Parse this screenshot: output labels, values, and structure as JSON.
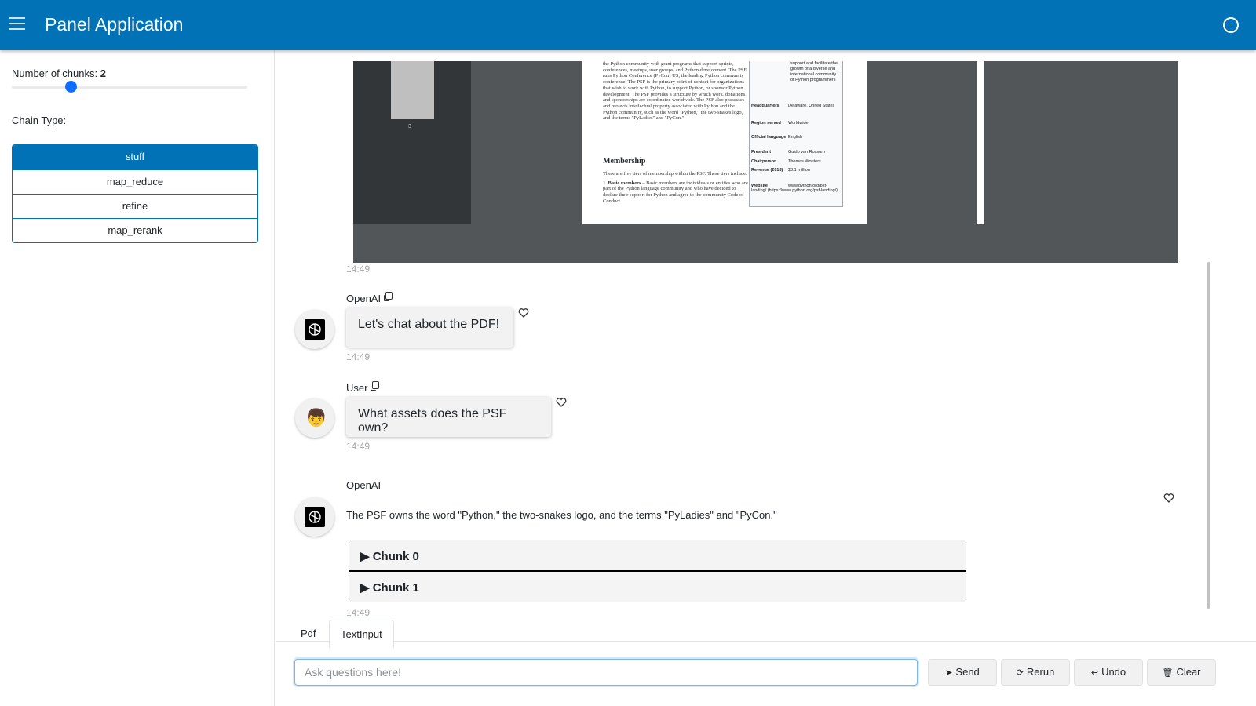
{
  "header": {
    "title": "Panel Application"
  },
  "sidebar": {
    "slider": {
      "label": "Number of chunks:",
      "value": "2",
      "fraction": 0.25
    },
    "chain_type_label": "Chain Type:",
    "chain_options": [
      "stuff",
      "map_reduce",
      "refine",
      "map_rerank"
    ],
    "selected_chain": "stuff"
  },
  "pdf": {
    "thumb_page_number": "3",
    "page_text": "the Python community with grant programs that support sprints, conferences, meetups, user groups, and Python development. The PSF runs Python Conference (PyCon) US, the leading Python community conference. The PSF is the primary point of contact for organizations that wish to work with Python, to support Python, or sponsor Python development. The PSF provides a structure by which work, donations, and sponsorships are coordinated worldwide. The PSF also possesses and protects intellectual property associated with Python and the Python community, such as the word \"Python,\" the two-snakes logo, and the terms \"PyLadies\" and \"PyCon.\"",
    "section_heading": "Membership",
    "section_text": "There are five tiers of membership within the PSF. These tiers include:",
    "list_item_title": "1. Basic members",
    "list_item_text": "– Basic members are individuals or entities who are part of the Python language community and who have decided to declare their support for Python and agree to the community Code of Conduct.",
    "infobox": {
      "top_text": "support and facilitate the growth of a diverse and international community of Python programmers",
      "rows": [
        {
          "key": "Headquarters",
          "value": "Delaware, United States"
        },
        {
          "key": "Region served",
          "value": "Worldwide"
        },
        {
          "key": "Official language",
          "value": "English"
        },
        {
          "key": "President",
          "value": "Guido van Rossum"
        },
        {
          "key": "Chairperson",
          "value": "Thomas Wouters"
        },
        {
          "key": "Revenue (2018)",
          "value": "$3.1 million"
        },
        {
          "key": "Website",
          "value": "www.python.org/psf-landing/ (https://www.python.org/psf-landing/)"
        }
      ]
    }
  },
  "chat": {
    "messages": [
      {
        "timestamp": "14:49"
      },
      {
        "sender": "OpenAI",
        "text": "Let's chat about the PDF!",
        "timestamp": "14:49",
        "avatar": "openai-logo-icon"
      },
      {
        "sender": "User",
        "text": "What assets does the PSF own?",
        "timestamp": "14:49",
        "avatar": "👦"
      },
      {
        "sender": "OpenAI",
        "text": "The PSF owns the word \"Python,\" the two-snakes logo, and the terms \"PyLadies\" and \"PyCon.\"",
        "timestamp": "14:49",
        "avatar": "openai-logo-icon"
      }
    ],
    "chunks": [
      "Chunk 0",
      "Chunk 1"
    ],
    "chunk_marker": "▶"
  },
  "tabs": [
    "Pdf",
    "TextInput"
  ],
  "active_tab": "TextInput",
  "input": {
    "placeholder": "Ask questions here!",
    "value": ""
  },
  "buttons": {
    "send": "Send",
    "rerun": "Rerun",
    "undo": "Undo",
    "clear": "Clear"
  },
  "icons": {
    "send": "➤",
    "rerun": "⟳",
    "undo": "↩",
    "clear": "🗑"
  },
  "colors": {
    "header_bg": "#0072b5",
    "accent": "#0d6efd"
  }
}
